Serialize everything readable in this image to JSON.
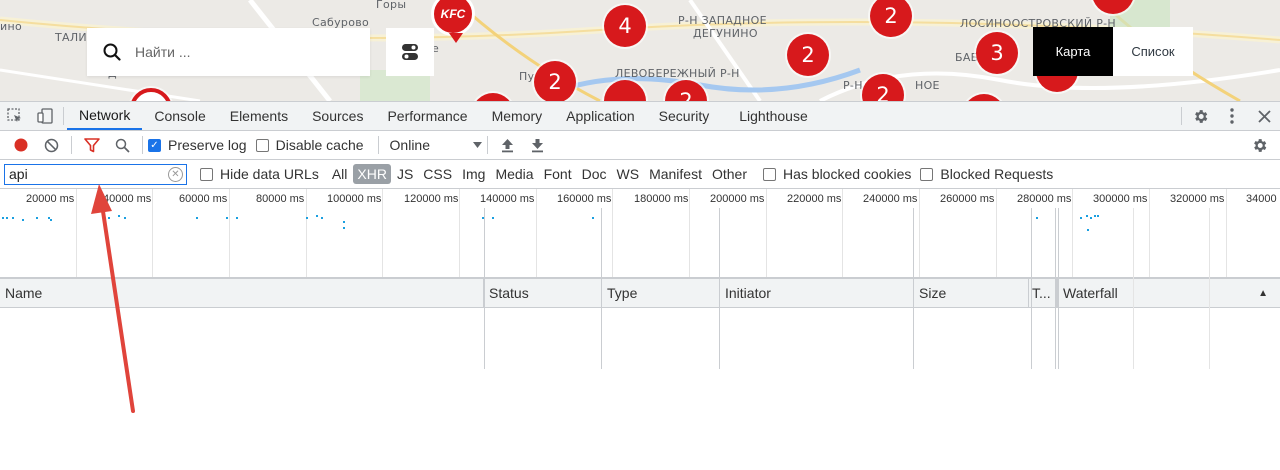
{
  "map": {
    "labels": [
      "ино",
      "ТАЛИ",
      "Сабурово",
      "Д",
      "Пу",
      "ое",
      "Р-Н ЗАПАДНОЕ",
      "ДЕГУНИНО",
      "ЛЕВОБЕРЕЖНЫЙ Р-Н",
      "Р-Н",
      "ЛОСИНООСТРОВСКИЙ Р-Н",
      "БАБУШК",
      "НОЕ",
      "Горы"
    ],
    "clusters": [
      "4",
      "2",
      "2",
      "2",
      "2",
      "3",
      "2"
    ],
    "kfc_label": "KFC",
    "search_placeholder": "Найти ...",
    "view_map": "Карта",
    "view_list": "Список",
    "brand_color": "#d7191c"
  },
  "devtools": {
    "tabs": [
      "Network",
      "Console",
      "Elements",
      "Sources",
      "Performance",
      "Memory",
      "Application",
      "Security",
      "Lighthouse"
    ],
    "active_tab": "Network",
    "toolbar": {
      "preserve_log": "Preserve log",
      "preserve_log_checked": true,
      "disable_cache": "Disable cache",
      "disable_cache_checked": false,
      "throttling": "Online"
    },
    "filter": {
      "value": "api",
      "hide_data_urls": "Hide data URLs",
      "types": [
        "All",
        "XHR",
        "JS",
        "CSS",
        "Img",
        "Media",
        "Font",
        "Doc",
        "WS",
        "Manifest",
        "Other"
      ],
      "selected_type": "XHR",
      "has_blocked_cookies": "Has blocked cookies",
      "blocked_requests": "Blocked Requests"
    },
    "overview_ticks": [
      "20000 ms",
      "40000 ms",
      "60000 ms",
      "80000 ms",
      "100000 ms",
      "120000 ms",
      "140000 ms",
      "160000 ms",
      "180000 ms",
      "200000 ms",
      "220000 ms",
      "240000 ms",
      "260000 ms",
      "280000 ms",
      "300000 ms",
      "320000 ms",
      "34000"
    ],
    "columns": [
      "Name",
      "Status",
      "Type",
      "Initiator",
      "Size",
      "T...",
      "Waterfall"
    ],
    "sort_indicator": "▲"
  }
}
